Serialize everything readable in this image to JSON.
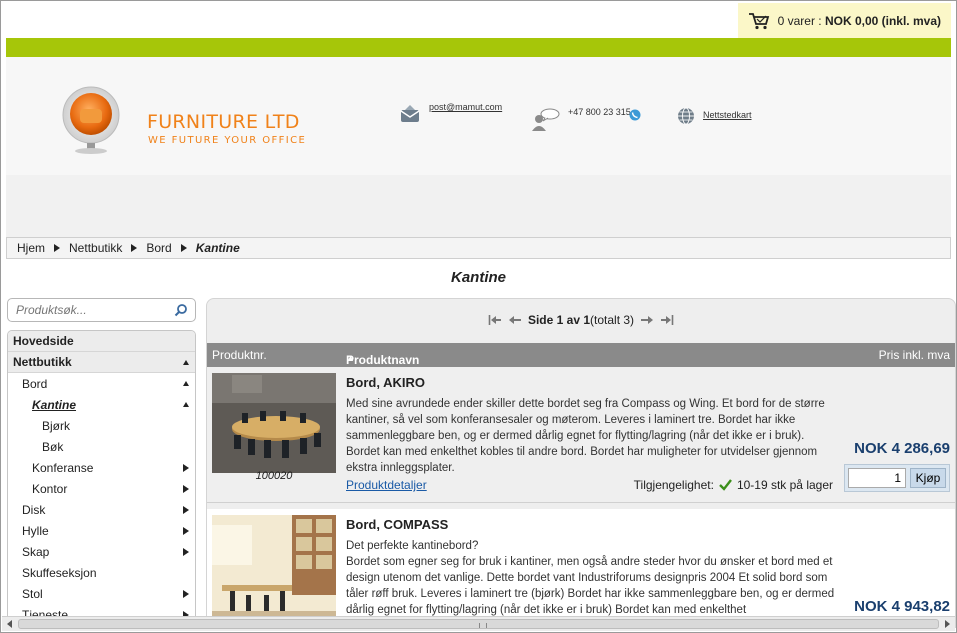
{
  "cart": {
    "summary": "0 varer : ",
    "total": "NOK 0,00 (inkl. mva)"
  },
  "brand": {
    "name": "FURNITURE LTD",
    "tagline": "WE FUTURE YOUR OFFICE"
  },
  "contact": {
    "email": "post@mamut.com",
    "phone": "+47 800 23 315",
    "sitemap": "Nettstedkart"
  },
  "breadcrumb": [
    "Hjem",
    "Nettbutikk",
    "Bord",
    "Kantine"
  ],
  "page_title": "Kantine",
  "search": {
    "placeholder": "Produktsøk..."
  },
  "sidebar": {
    "items": [
      {
        "label": "Hovedside"
      },
      {
        "label": "Nettbutikk"
      },
      {
        "label": "Bord"
      },
      {
        "label": "Kantine"
      },
      {
        "label": "Bjørk"
      },
      {
        "label": "Bøk"
      },
      {
        "label": "Konferanse"
      },
      {
        "label": "Kontor"
      },
      {
        "label": "Disk"
      },
      {
        "label": "Hylle"
      },
      {
        "label": "Skap"
      },
      {
        "label": "Skuffeseksjon"
      },
      {
        "label": "Stol"
      },
      {
        "label": "Tjeneste"
      }
    ]
  },
  "pager": {
    "label": "Side 1 av 1",
    "total": "(totalt 3)"
  },
  "table": {
    "col_nr": "Produktnr.",
    "col_name": "Produktnavn",
    "col_price": "Pris inkl. mva"
  },
  "products": [
    {
      "nr": "100020",
      "name": "Bord, AKIRO",
      "description": "Med sine avrundede ender skiller dette bordet seg fra Compass og Wing. Et bord for de større kantiner, så vel som konferansesaler og møterom. Leveres i laminert tre. Bordet har ikke sammenleggbare ben, og er dermed dårlig egnet for flytting/lagring (når det ikke er i bruk). Bordet kan med enkelthet kobles til andre bord. Bordet har muligheter for utvidelser gjennom ekstra innleggsplater.",
      "details_link": "Produktdetaljer",
      "availability_label": "Tilgjengelighet:",
      "availability": "10-19 stk på lager",
      "price": "NOK 4 286,69",
      "qty": "1",
      "buy": "Kjøp"
    },
    {
      "name": "Bord, COMPASS",
      "description": "Det perfekte kantinebord?\nBordet som egner seg for bruk i kantiner, men også andre steder hvor du ønsker et bord med et design utenom det vanlige. Dette bordet vant Industriforums designpris 2004 Et solid bord som tåler røff bruk. Leveres i laminert tre (bjørk) Bordet har ikke sammenleggbare ben, og er dermed dårlig egnet for flytting/lagring (når det ikke er i bruk) Bordet kan med enkelthet",
      "price": "NOK 4 943,82"
    }
  ],
  "colors": {
    "accent_green": "#a6c609",
    "brand_orange": "#f0821a",
    "price_blue": "#1a3f6e"
  }
}
